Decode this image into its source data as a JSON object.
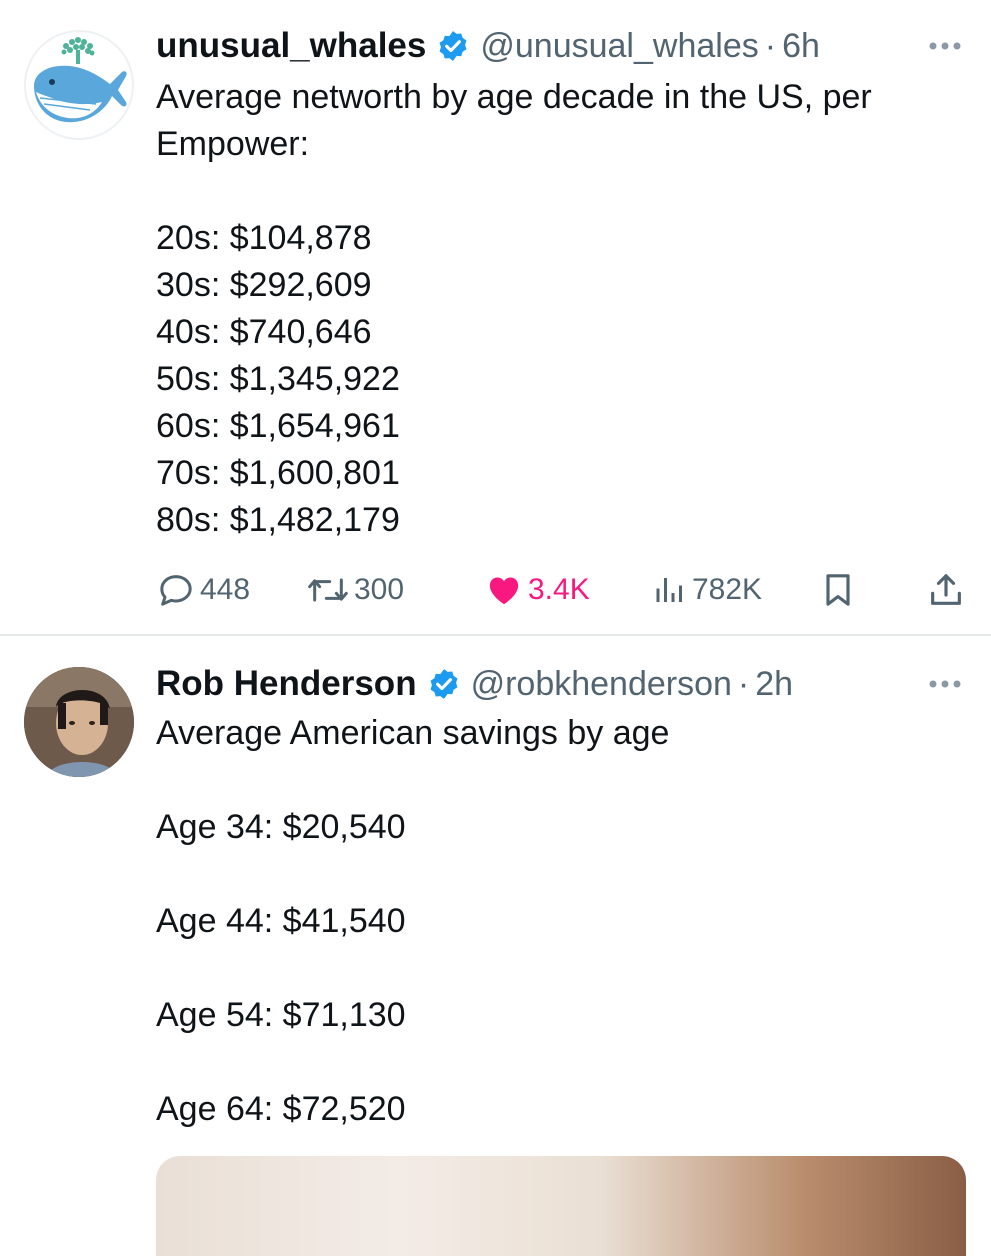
{
  "tweets": [
    {
      "display_name": "unusual_whales",
      "handle": "@unusual_whales",
      "separator": "·",
      "time": "6h",
      "text": "Average networth by age decade in the US, per Empower:\n\n20s: $104,878\n30s: $292,609\n40s: $740,646\n50s: $1,345,922\n60s: $1,654,961\n70s: $1,600,801\n80s: $1,482,179",
      "actions": {
        "replies": "448",
        "retweets": "300",
        "likes": "3.4K",
        "views": "782K"
      },
      "liked": true
    },
    {
      "display_name": "Rob Henderson",
      "handle": "@robkhenderson",
      "separator": "·",
      "time": "2h",
      "text": "Average American savings by age\n\nAge 34: $20,540\n\nAge 44: $41,540\n\nAge 54: $71,130\n\nAge 64: $72,520"
    }
  ],
  "icons": {
    "verified": "verified-badge-icon",
    "more": "more-options-icon",
    "reply": "reply-icon",
    "retweet": "retweet-icon",
    "like": "heart-icon",
    "views": "views-icon",
    "bookmark": "bookmark-icon",
    "share": "share-icon"
  },
  "colors": {
    "verified": "#1d9bf0",
    "like_active": "#f91880",
    "secondary_text": "#536471",
    "primary_text": "#0f1419",
    "divider": "#e6e9eb"
  }
}
